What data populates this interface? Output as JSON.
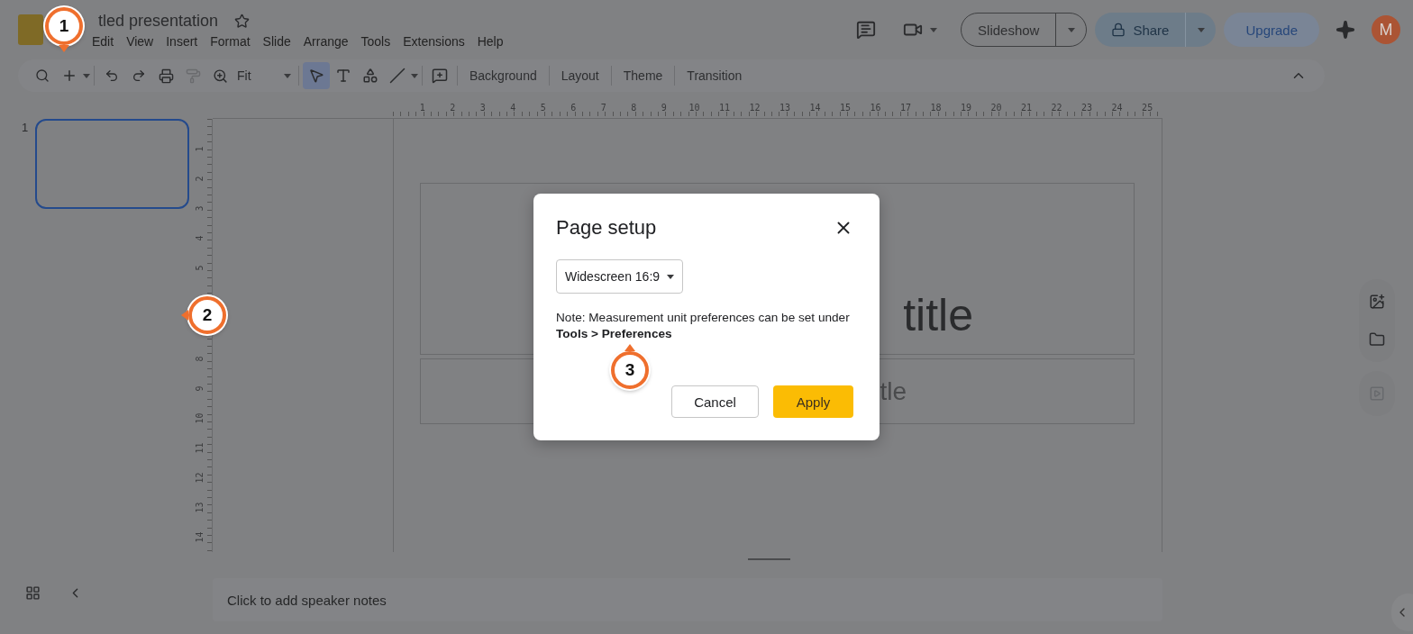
{
  "header": {
    "title": "tled presentation",
    "menu": [
      "Edit",
      "View",
      "Insert",
      "Format",
      "Slide",
      "Arrange",
      "Tools",
      "Extensions",
      "Help"
    ],
    "slideshow": "Slideshow",
    "share": "Share",
    "upgrade": "Upgrade",
    "avatar": "M"
  },
  "toolbar": {
    "zoom": "Fit",
    "format_painter_disabled": true,
    "tools": [
      {
        "kind": "select",
        "selected": true
      },
      {
        "kind": "text",
        "selected": false
      },
      {
        "kind": "shape",
        "selected": false
      },
      {
        "kind": "line",
        "selected": false
      }
    ],
    "buttons": [
      "Background",
      "Layout",
      "Theme",
      "Transition"
    ]
  },
  "filmstrip": {
    "slides": [
      {
        "number": "1",
        "selected": true
      }
    ]
  },
  "rulers": {
    "horizontal": [
      "1",
      "2",
      "3",
      "4",
      "5",
      "6",
      "7",
      "8",
      "9",
      "10",
      "11",
      "12",
      "13",
      "14",
      "15",
      "16",
      "17",
      "18",
      "19",
      "20",
      "21",
      "22",
      "23",
      "24",
      "25"
    ],
    "vertical": [
      "1",
      "2",
      "3",
      "4",
      "5",
      "8",
      "9",
      "10",
      "11",
      "12",
      "13",
      "14"
    ]
  },
  "slide": {
    "title": "title",
    "subtitle": "tle"
  },
  "speaker_notes": {
    "placeholder": "Click to add speaker notes"
  },
  "dialog": {
    "title": "Page setup",
    "size": "Widescreen 16:9",
    "note": "Note: Measurement unit preferences can be set under **Tools > Preferences**",
    "buttons": [
      {
        "label": "Cancel",
        "kind": "secondary"
      },
      {
        "label": "Apply",
        "kind": "primary"
      }
    ]
  },
  "callouts": [
    {
      "number": "1"
    },
    {
      "number": "2"
    },
    {
      "number": "3"
    }
  ]
}
